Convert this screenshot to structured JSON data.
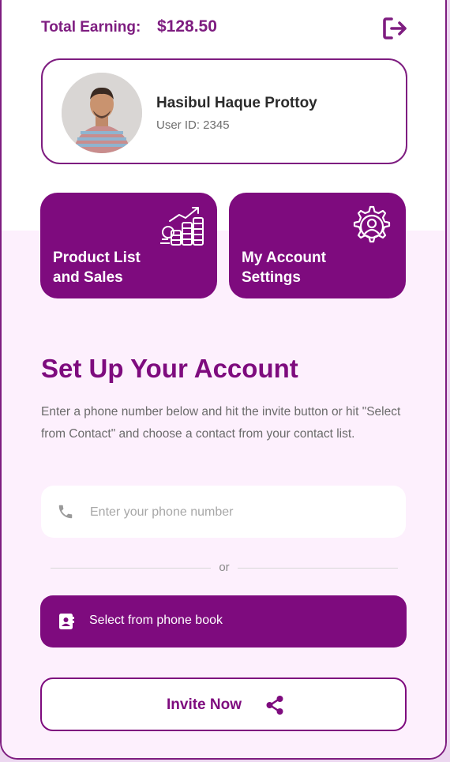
{
  "header": {
    "earning_label": "Total Earning:",
    "earning_value": "$128.50",
    "logout_icon": "logout-icon"
  },
  "profile": {
    "name": "Hasibul Haque Prottoy",
    "user_id": "User ID: 2345"
  },
  "tiles": [
    {
      "label": "Product List\nand Sales",
      "icon": "chart-coins-icon"
    },
    {
      "label": "My Account\nSettings",
      "icon": "gear-user-icon"
    }
  ],
  "setup": {
    "title": "Set Up Your Account",
    "description": "Enter a phone number below and hit the invite button or hit \"Select from Contact\" and choose a contact from your contact list.",
    "phone_placeholder": "Enter your phone number",
    "phone_value": "",
    "or_label": "or",
    "phonebook_label": "Select from phone book",
    "invite_label": "Invite Now"
  },
  "colors": {
    "primary": "#7e0b7e",
    "page_bg": "#fdf0fd",
    "outer_bg": "#ecd7f0"
  }
}
